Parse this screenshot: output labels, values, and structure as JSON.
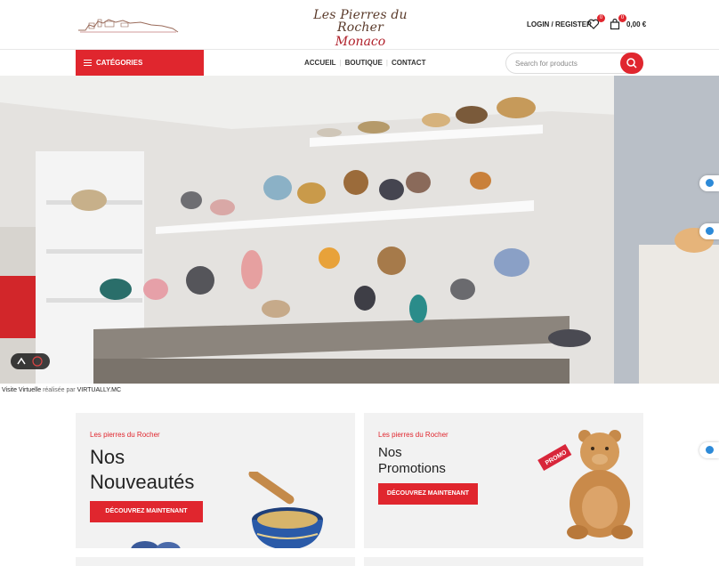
{
  "header": {
    "brand_line1": "Les Pierres du Rocher",
    "brand_line2": "Monaco",
    "login_label": "LOGIN / REGISTER",
    "wishlist_count": "0",
    "cart_count": "0",
    "cart_total": "0,00 €"
  },
  "nav": {
    "categories_label": "CATÉGORIES",
    "menu": [
      "ACCUEIL",
      "BOUTIQUE",
      "CONTACT"
    ],
    "search_placeholder": "Search for products"
  },
  "hero": {
    "credit_prefix": "Visite Virtuelle",
    "credit_middle": "réalisée par",
    "credit_brand": "VIRTUALLY.MC"
  },
  "banners": [
    {
      "kicker": "Les pierres du Rocher",
      "title_line1": "Nos",
      "title_line2": "Nouveautés",
      "cta": "DÉCOUVREZ MAINTENANT"
    },
    {
      "kicker": "Les pierres du Rocher",
      "title_line1": "Nos",
      "title_line2": "Promotions",
      "cta": "DÉCOUVREZ MAINTENANT",
      "tag": "PROMO"
    }
  ],
  "colors": {
    "accent": "#e0262e",
    "banner_bg": "#f2f2f2"
  }
}
